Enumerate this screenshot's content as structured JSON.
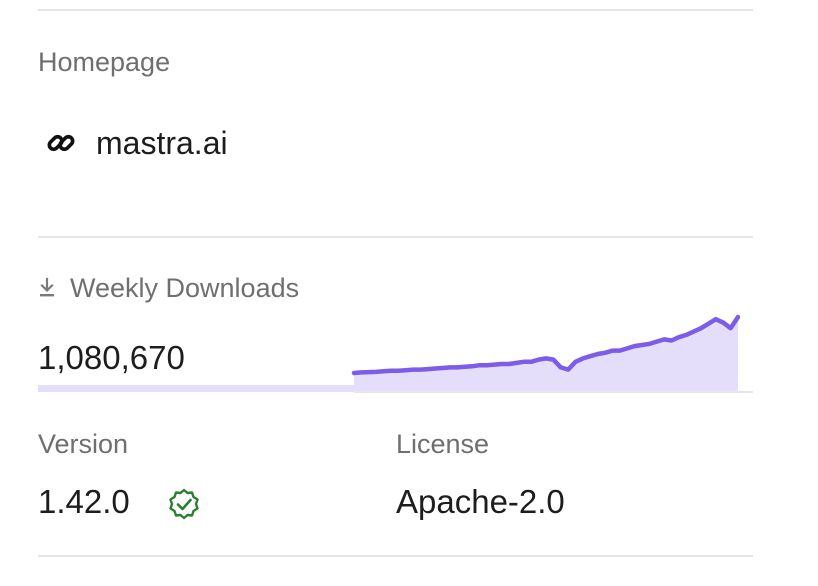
{
  "homepage": {
    "label": "Homepage",
    "url_text": "mastra.ai",
    "icon": "link-icon"
  },
  "downloads": {
    "label": "Weekly Downloads",
    "icon": "download-icon",
    "count": "1,080,670",
    "color_line": "#7c5ce9",
    "color_fill": "#e5defb"
  },
  "chart_data": {
    "type": "area",
    "x": [
      0,
      1,
      2,
      3,
      4,
      5,
      6,
      7,
      8,
      9,
      10,
      11,
      12,
      13,
      14,
      15,
      16,
      17,
      18,
      19,
      20,
      21,
      22,
      23,
      24,
      25,
      26,
      27,
      28,
      29,
      30,
      31,
      32,
      33,
      34,
      35,
      36,
      37,
      38,
      39,
      40,
      41,
      42,
      43,
      44,
      45,
      46,
      47,
      48,
      49,
      50,
      51,
      52
    ],
    "values": [
      0,
      0.005,
      0.008,
      0.01,
      0.015,
      0.02,
      0.02,
      0.025,
      0.03,
      0.03,
      0.035,
      0.04,
      0.045,
      0.05,
      0.05,
      0.055,
      0.06,
      0.07,
      0.07,
      0.075,
      0.08,
      0.08,
      0.09,
      0.1,
      0.1,
      0.12,
      0.13,
      0.12,
      0.05,
      0.03,
      0.1,
      0.13,
      0.15,
      0.17,
      0.18,
      0.2,
      0.2,
      0.22,
      0.24,
      0.25,
      0.26,
      0.28,
      0.3,
      0.29,
      0.32,
      0.34,
      0.37,
      0.4,
      0.44,
      0.48,
      0.45,
      0.4,
      0.5
    ],
    "title": "",
    "xlabel": "",
    "ylabel": ""
  },
  "version": {
    "label": "Version",
    "value": "1.42.0",
    "icon": "verified-check-icon",
    "icon_color": "#2e7d32"
  },
  "license": {
    "label": "License",
    "value": "Apache-2.0"
  }
}
